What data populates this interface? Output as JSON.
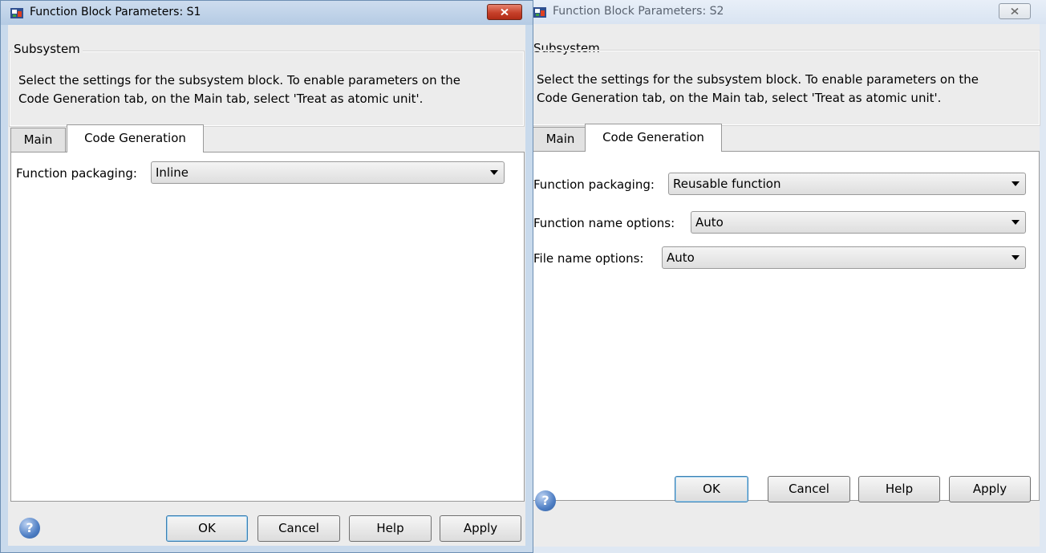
{
  "windows": [
    {
      "title": "Function Block Parameters: S1",
      "group_label": "Subsystem",
      "description": [
        "Select the settings for the subsystem block. To enable parameters on the",
        "Code Generation tab, on the Main tab, select 'Treat as atomic unit'."
      ],
      "tabs": [
        "Main",
        "Code Generation"
      ],
      "active_tab": "Code Generation",
      "fields": [
        {
          "label": "Function packaging:",
          "value": "Inline"
        }
      ],
      "buttons": {
        "ok": "OK",
        "cancel": "Cancel",
        "help": "Help",
        "apply": "Apply"
      },
      "help_icon": "?"
    },
    {
      "title": "Function Block Parameters: S2",
      "group_label": "Subsystem",
      "description": [
        "Select the settings for the subsystem block. To enable parameters on the",
        "Code Generation tab, on the Main tab, select 'Treat as atomic unit'."
      ],
      "tabs": [
        "Main",
        "Code Generation"
      ],
      "active_tab": "Code Generation",
      "fields": [
        {
          "label": "Function packaging:",
          "value": "Reusable function"
        },
        {
          "label": "Function name options:",
          "value": "Auto"
        },
        {
          "label": "File name options:",
          "value": "Auto"
        }
      ],
      "buttons": {
        "ok": "OK",
        "cancel": "Cancel",
        "help": "Help",
        "apply": "Apply"
      },
      "help_icon": "?"
    }
  ],
  "colors": {
    "active_close": "#c6402a",
    "default_button_border": "#3c7fb1",
    "title_active": "#b5cbe4",
    "title_inactive": "#d9e4f2"
  },
  "icons": [
    "simulink-block-icon",
    "close-icon",
    "chevron-down-icon",
    "help-icon"
  ]
}
